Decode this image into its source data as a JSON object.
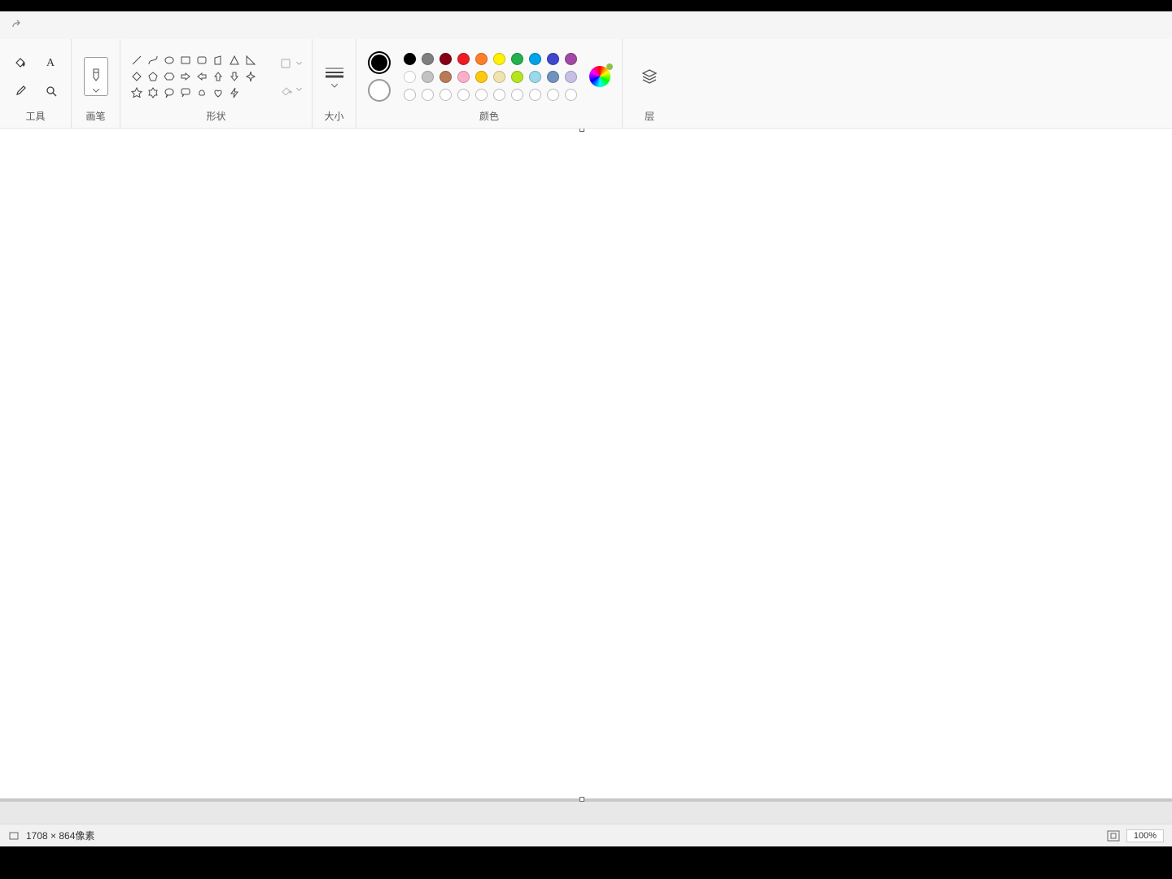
{
  "quickbar": {
    "redo_label": "redo"
  },
  "groups": {
    "tools": "工具",
    "brush": "画笔",
    "shapes": "形状",
    "size": "大小",
    "colors": "颜色",
    "layers": "层"
  },
  "colors": {
    "primary": "#000000",
    "secondary": "#ffffff",
    "row1": [
      "#000000",
      "#7f7f7f",
      "#880015",
      "#ed1c24",
      "#ff7f27",
      "#fff200",
      "#22b14c",
      "#00a2e8",
      "#3f48cc",
      "#a349a4"
    ],
    "row2": [
      "#ffffff",
      "#c3c3c3",
      "#b97a57",
      "#ffaec9",
      "#ffc90e",
      "#efe4b0",
      "#b5e61d",
      "#99d9ea",
      "#7092be",
      "#c8bfe7"
    ],
    "custom_slots": 10
  },
  "status": {
    "size_label": "1708 × 864像素",
    "zoom": "100%"
  }
}
